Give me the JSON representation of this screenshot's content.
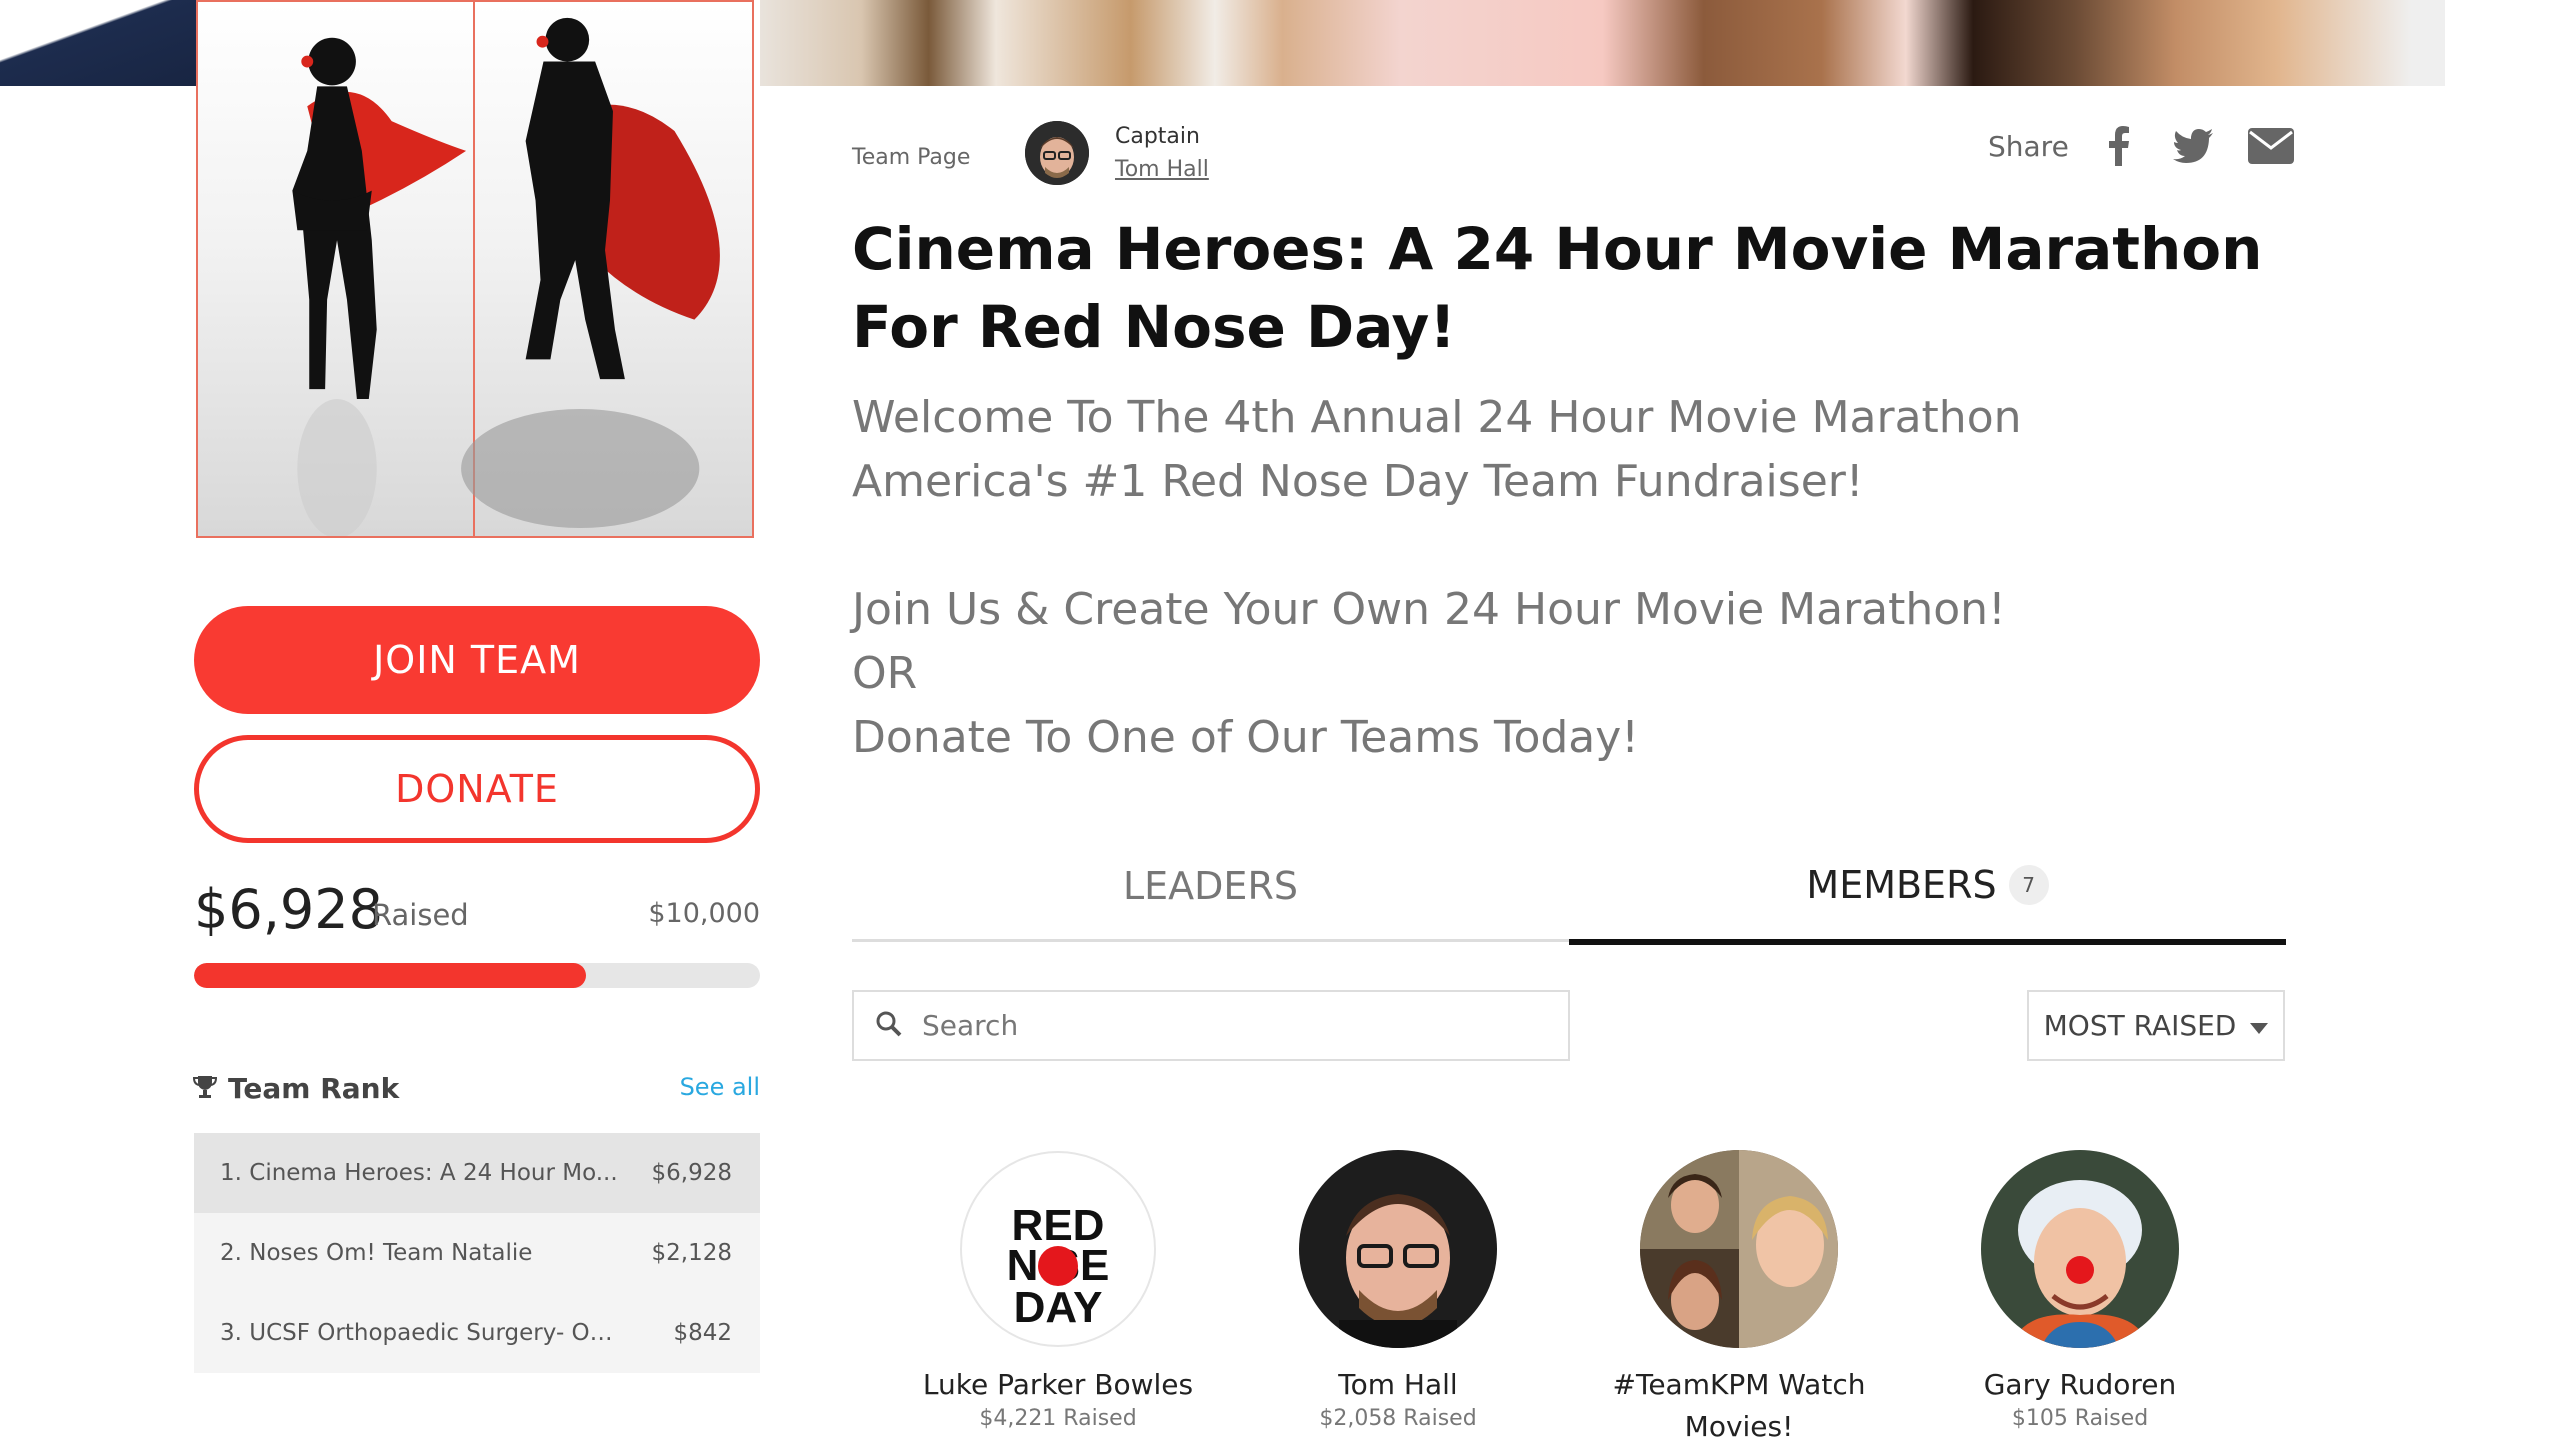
{
  "team_page_label": "Team Page",
  "captain": {
    "label": "Captain",
    "name": "Tom Hall"
  },
  "share": {
    "label": "Share",
    "icons": [
      "facebook-icon",
      "twitter-icon",
      "envelope-icon"
    ]
  },
  "title": "Cinema Heroes: A 24 Hour Movie Marathon For Red Nose Day!",
  "description": {
    "line1": "Welcome To The 4th Annual 24 Hour Movie Marathon",
    "line2": "America's #1 Red Nose Day Team Fundraiser!",
    "line3": "Join Us & Create Your Own 24 Hour Movie Marathon!",
    "line4": "OR",
    "line5": "Donate To One of Our Teams Today!"
  },
  "actions": {
    "join": "JOIN TEAM",
    "donate": "DONATE"
  },
  "fundraising": {
    "raised": "$6,928",
    "raised_label": "Raised",
    "goal": "$10,000",
    "progress_fraction": 0.6928
  },
  "team_rank": {
    "title": "Team Rank",
    "see_all": "See all",
    "rows": [
      {
        "name": "1. Cinema Heroes: A 24 Hour Mo...",
        "amount": "$6,928"
      },
      {
        "name": "2. Noses Om! Team Natalie",
        "amount": "$2,128"
      },
      {
        "name": "3. UCSF Orthopaedic Surgery- Ort...",
        "amount": "$842"
      }
    ]
  },
  "tabs": {
    "leaders": "LEADERS",
    "members": "MEMBERS",
    "members_count": "7"
  },
  "search": {
    "placeholder": "Search"
  },
  "sort": {
    "selected": "MOST RAISED"
  },
  "members": [
    {
      "name": "Luke Parker Bowles",
      "raised": "$4,221 Raised",
      "logo_text": "RED NOSE DAY"
    },
    {
      "name": "Tom Hall",
      "raised": "$2,058 Raised"
    },
    {
      "name": "#TeamKPM Watch Movies!",
      "raised": ""
    },
    {
      "name": "Gary Rudoren",
      "raised": "$105 Raised"
    }
  ],
  "colors": {
    "accent": "#f3352d",
    "link": "#29a8e0"
  }
}
